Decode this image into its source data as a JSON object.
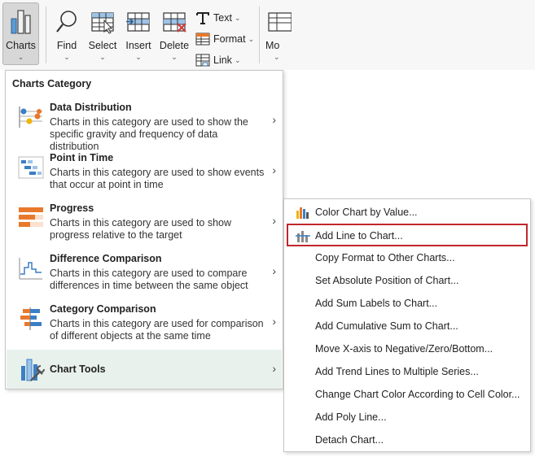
{
  "ribbon": {
    "charts": {
      "label": "Charts",
      "icon": "bar-chart-icon"
    },
    "find": {
      "label": "Find",
      "icon": "magnifier-icon"
    },
    "select": {
      "label": "Select",
      "icon": "select-grid-icon"
    },
    "insert": {
      "label": "Insert",
      "icon": "insert-rows-icon"
    },
    "delete": {
      "label": "Delete",
      "icon": "delete-grid-icon"
    },
    "text": {
      "label": "Text",
      "icon": "text-t-icon"
    },
    "format": {
      "label": "Format",
      "icon": "format-icon"
    },
    "link": {
      "label": "Link",
      "icon": "link-icon"
    },
    "more": {
      "label": "Mo",
      "icon": "more-grid-icon"
    },
    "caret": "⌄",
    "small_caret": "⌄"
  },
  "categories": {
    "header": "Charts Category",
    "items": [
      {
        "title": "Data Distribution",
        "desc": "Charts in this category are used to show the specific gravity and frequency of data distribution",
        "icon": "data-distribution-icon"
      },
      {
        "title": "Point in Time",
        "desc": "Charts in this category are used to show events that occur at point in time",
        "icon": "point-in-time-icon"
      },
      {
        "title": "Progress",
        "desc": "Charts in this category are used to show progress relative to the target",
        "icon": "progress-icon"
      },
      {
        "title": "Difference Comparison",
        "desc": "Charts in this category are used to compare differences in time between the same object",
        "icon": "difference-comparison-icon"
      },
      {
        "title": "Category Comparison",
        "desc": "Charts in this category are used for comparison of different objects at the same time",
        "icon": "category-comparison-icon"
      }
    ],
    "tools": {
      "title": "Chart Tools",
      "icon": "chart-tools-icon"
    },
    "arrow": "›"
  },
  "tools_menu": {
    "items": [
      {
        "label": "Color Chart by Value...",
        "icon": "color-chart-icon"
      },
      {
        "label": "Add Line to Chart...",
        "icon": "add-line-icon"
      },
      {
        "label": "Copy Format to Other Charts..."
      },
      {
        "label": "Set Absolute Position of Chart..."
      },
      {
        "label": "Add Sum Labels to Chart..."
      },
      {
        "label": "Add Cumulative Sum to Chart..."
      },
      {
        "label": "Move X-axis to Negative/Zero/Bottom..."
      },
      {
        "label": "Add Trend Lines to Multiple Series..."
      },
      {
        "label": "Change Chart Color According to Cell Color..."
      },
      {
        "label": "Add Poly Line..."
      },
      {
        "label": "Detach Chart..."
      }
    ]
  },
  "colors": {
    "highlight_border": "#c0272d",
    "tools_bg": "#e9f1ec",
    "accent_orange": "#e8792c",
    "accent_blue": "#3b7fc4"
  }
}
